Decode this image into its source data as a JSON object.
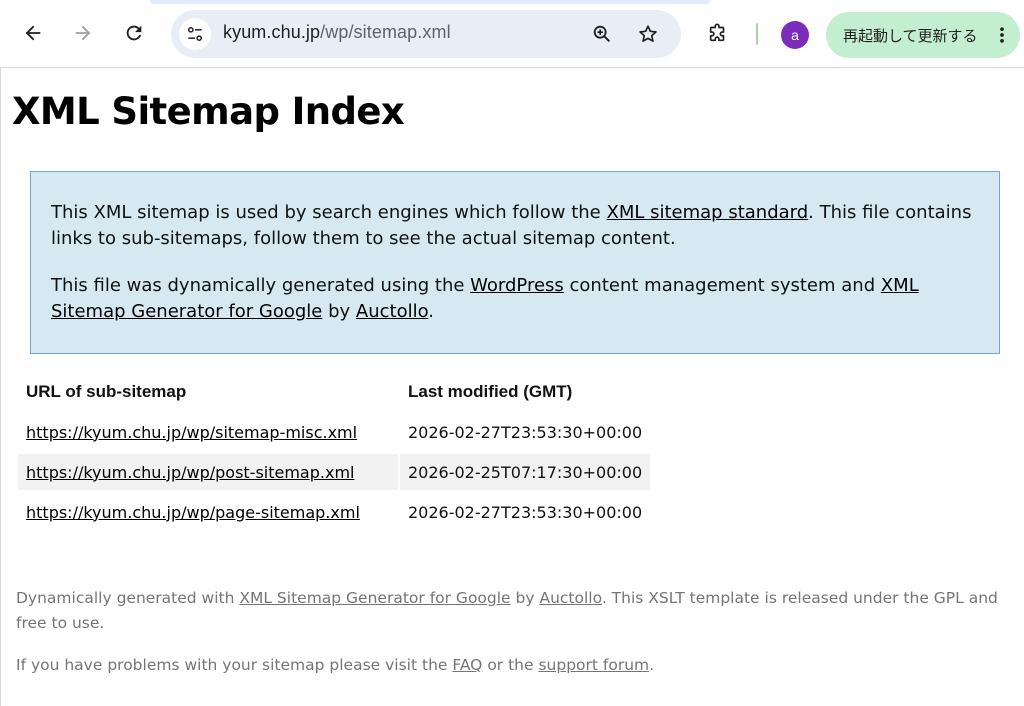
{
  "browser": {
    "url_host": "kyum.chu.jp",
    "url_path": "/wp/sitemap.xml",
    "avatar_letter": "a",
    "restart_label": "再起動して更新する",
    "icons": [
      "back-arrow-icon",
      "forward-arrow-icon",
      "reload-icon",
      "site-info-icon",
      "zoom-icon",
      "bookmark-star-icon",
      "extensions-puzzle-icon",
      "more-vert-icon"
    ]
  },
  "page": {
    "title": "XML Sitemap Index",
    "intro": {
      "p1_text_a": "This XML sitemap is used by search engines which follow the ",
      "p1_link": "XML sitemap standard",
      "p1_text_b": ". This file contains links to sub-sitemaps, follow them to see the actual sitemap content.",
      "p2_text_a": "This file was dynamically generated using the ",
      "p2_link_wp": "WordPress",
      "p2_text_b": " content management system and ",
      "p2_link_gen": "XML Sitemap Generator for Google",
      "p2_text_c": " by ",
      "p2_link_author": "Auctollo",
      "p2_text_d": "."
    },
    "table": {
      "headers": [
        "URL of sub-sitemap",
        "Last modified (GMT)"
      ],
      "rows": [
        {
          "url": "https://kyum.chu.jp/wp/sitemap-misc.xml",
          "modified": "2026-02-27T23:53:30+00:00"
        },
        {
          "url": "https://kyum.chu.jp/wp/post-sitemap.xml",
          "modified": "2026-02-25T07:17:30+00:00"
        },
        {
          "url": "https://kyum.chu.jp/wp/page-sitemap.xml",
          "modified": "2026-02-27T23:53:30+00:00"
        }
      ]
    },
    "footer": {
      "f1_text_a": "Dynamically generated with ",
      "f1_link_gen": "XML Sitemap Generator for Google",
      "f1_text_b": " by ",
      "f1_link_author": "Auctollo",
      "f1_text_c": ". This XSLT template is released under the GPL and free to use.",
      "f2_text_a": "If you have problems with your sitemap please visit the ",
      "f2_link_faq": "FAQ",
      "f2_text_b": " or the ",
      "f2_link_forum": "support forum",
      "f2_text_c": "."
    }
  }
}
